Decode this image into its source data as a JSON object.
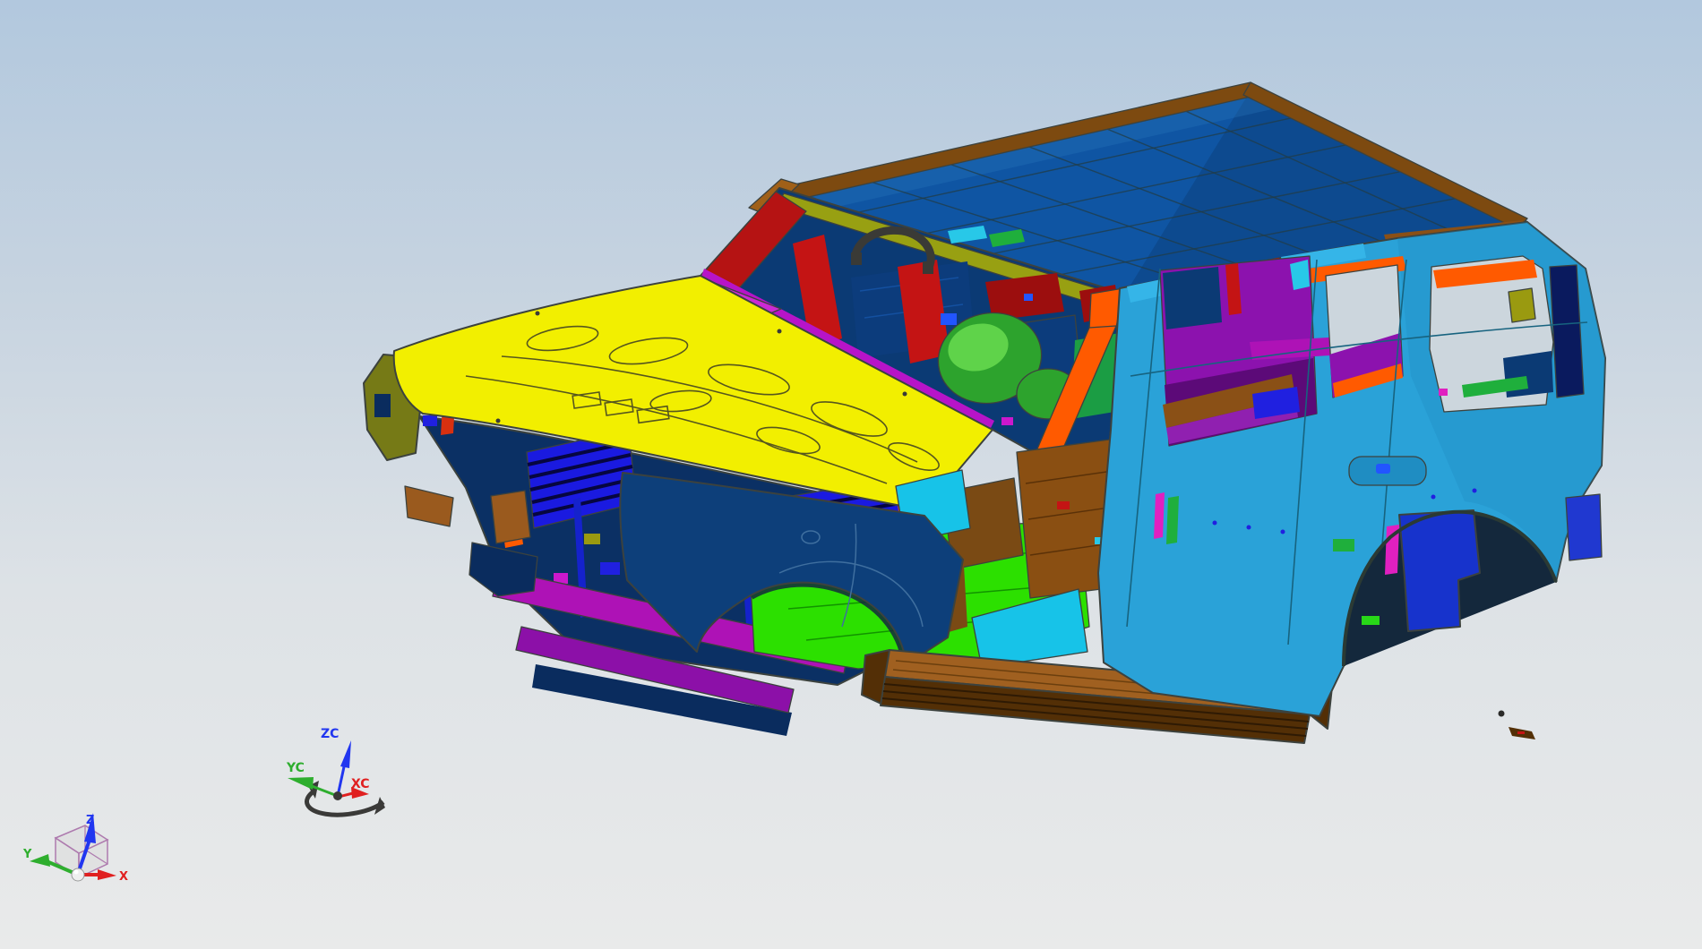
{
  "viewport": {
    "background_top": "#b2c8de",
    "background_bottom": "#e9eaea"
  },
  "wcs_triad": {
    "z_label": "ZC",
    "y_label": "YC",
    "x_label": "XC",
    "z_color": "#2136f0",
    "y_color": "#2eae2e",
    "x_color": "#e02020",
    "handle_color": "#3a3a38"
  },
  "datum_csys": {
    "z_label": "Z",
    "y_label": "Y",
    "x_label": "X",
    "z_color": "#2136f0",
    "y_color": "#2eae2e",
    "x_color": "#e02020",
    "cube_edge_color": "#a86fa8",
    "cube_face_color": "#d8d8d8",
    "ball_color": "#efefef"
  },
  "model": {
    "kind": "car-body-in-white",
    "parts": {
      "roof": {
        "color": "#0f55a3"
      },
      "roof_sheen": {
        "color": "#2a7ac0"
      },
      "roof_shade": {
        "color": "#041c38"
      },
      "roof_rail": {
        "color": "#7d4a10"
      },
      "roof_rail_light": {
        "color": "#a06018"
      },
      "header_olive": {
        "color": "#98a012"
      },
      "a_pillar_red": {
        "color": "#b51313"
      },
      "hood": {
        "color": "#f2ef00"
      },
      "cowl_magenta": {
        "color": "#b714c8"
      },
      "cowl_triangle": {
        "color": "#cc2ad4"
      },
      "interior_navy": {
        "color": "#0b3a74"
      },
      "interior_navy_light": {
        "color": "#0c3c7c"
      },
      "interior_red": {
        "color": "#c41414"
      },
      "dark_red": {
        "color": "#9c0e0e"
      },
      "green_dome": {
        "color": "#2da32d"
      },
      "green_dome_light": {
        "color": "#5fd34a"
      },
      "grab_handle": {
        "color": "#3a3a36"
      },
      "glint_blue": {
        "color": "#2255ff"
      },
      "fender_olive": {
        "color": "#767a16"
      },
      "front_module_navy": {
        "color": "#0b3064"
      },
      "module_dark": {
        "color": "#0a2c5e"
      },
      "grille_blue": {
        "color": "#1a1ae0"
      },
      "strut_blue": {
        "color": "#1522cc"
      },
      "bumper_magenta": {
        "color": "#ae12b6"
      },
      "bumper_purple": {
        "color": "#8c10a8"
      },
      "copper": {
        "color": "#9a5a1e"
      },
      "orange": {
        "color": "#ff5a00"
      },
      "red_orange": {
        "color": "#d83010"
      },
      "pink": {
        "color": "#ff3fc3"
      },
      "lime": {
        "color": "#28d818"
      },
      "cyan_chip": {
        "color": "#18c0e0"
      },
      "olive_chip": {
        "color": "#9a9a10"
      },
      "magenta_chip": {
        "color": "#cc18cc"
      },
      "royal_chip": {
        "color": "#2020e0"
      },
      "fender_navy": {
        "color": "#0d3f7a"
      },
      "floor_lime": {
        "color": "#2ce000"
      },
      "floor_brown": {
        "color": "#8a4f12"
      },
      "floor_cyan": {
        "color": "#17c3e8"
      },
      "seat_brown": {
        "color": "#7a4a14"
      },
      "rocker_top": {
        "color": "#a06020"
      },
      "rocker_face": {
        "color": "#532f06"
      },
      "body_cyan": {
        "color": "#2aa2d8"
      },
      "body_cyan_dark": {
        "color": "#1f8dc2"
      },
      "eave_red": {
        "color": "#c41010"
      },
      "eave_cyan": {
        "color": "#35b5e8"
      },
      "window_purple": {
        "color": "#8c12ae"
      },
      "window_purple_dark": {
        "color": "#5c0a78"
      },
      "aperture_sky": {
        "color": "#ccd6dd"
      },
      "d_pillar_navy": {
        "color": "#0a1a5e"
      },
      "green_sliver": {
        "color": "#1faf3c"
      },
      "arch_box_blue": {
        "color": "#1733cc"
      },
      "arch_magenta": {
        "color": "#e020c0"
      },
      "arch_dark": {
        "color": "#14283c"
      },
      "rear_blue_patch": {
        "color": "#2038d0"
      },
      "part_dark": {
        "color": "#2a2a28"
      },
      "far_copper": {
        "color": "#8a5016"
      },
      "far_cyan": {
        "color": "#28c8e8"
      },
      "far_purple": {
        "color": "#9020b0"
      }
    }
  }
}
